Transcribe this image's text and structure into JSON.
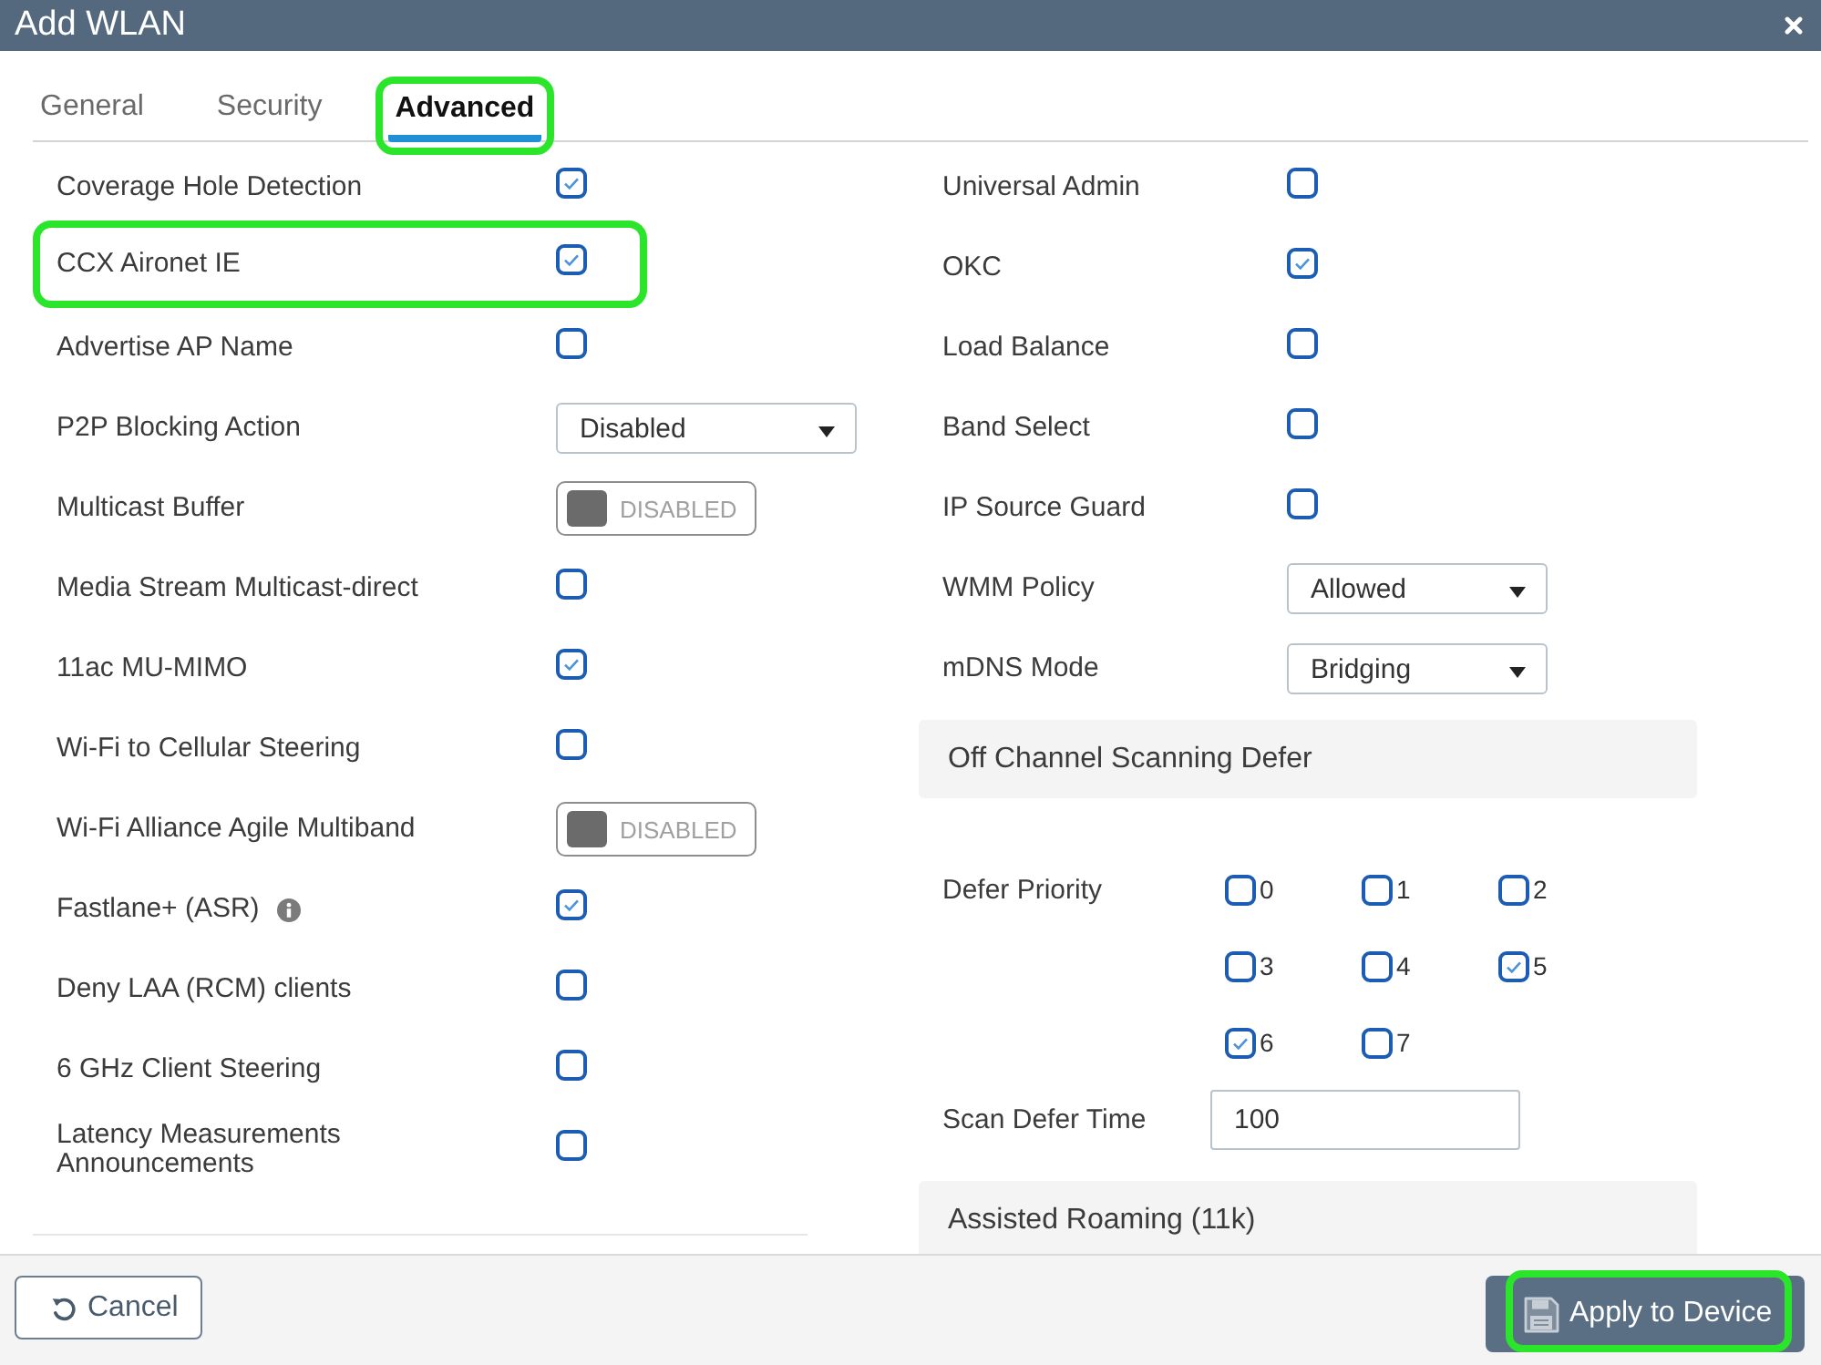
{
  "window": {
    "title": "Add WLAN"
  },
  "tabs": [
    {
      "label": "General",
      "selected": false,
      "highlighted": false
    },
    {
      "label": "Security",
      "selected": false,
      "highlighted": false
    },
    {
      "label": "Advanced",
      "selected": true,
      "highlighted": true
    }
  ],
  "left_settings": [
    {
      "kind": "checkbox",
      "label": "Coverage Hole Detection",
      "info": false,
      "highlighted": false,
      "checked": true
    },
    {
      "kind": "checkbox",
      "label": "CCX Aironet IE",
      "info": false,
      "highlighted": true,
      "checked": true
    },
    {
      "kind": "checkbox",
      "label": "Advertise AP Name",
      "info": false,
      "highlighted": false,
      "checked": false
    },
    {
      "kind": "select",
      "label": "P2P Blocking Action",
      "info": false,
      "highlighted": false,
      "value": "Disabled"
    },
    {
      "kind": "toggle",
      "label": "Multicast Buffer",
      "info": false,
      "highlighted": false,
      "on": false,
      "state_text": "DISABLED"
    },
    {
      "kind": "checkbox",
      "label": "Media Stream Multicast-direct",
      "info": false,
      "highlighted": false,
      "checked": false
    },
    {
      "kind": "checkbox",
      "label": "11ac MU-MIMO",
      "info": false,
      "highlighted": false,
      "checked": true
    },
    {
      "kind": "checkbox",
      "label": "Wi-Fi to Cellular Steering",
      "info": false,
      "highlighted": false,
      "checked": false
    },
    {
      "kind": "toggle",
      "label": "Wi-Fi Alliance Agile Multiband",
      "info": false,
      "highlighted": false,
      "on": false,
      "state_text": "DISABLED"
    },
    {
      "kind": "checkbox",
      "label": "Fastlane+ (ASR)",
      "info": true,
      "highlighted": false,
      "checked": true
    },
    {
      "kind": "checkbox",
      "label": "Deny LAA (RCM) clients",
      "info": false,
      "highlighted": false,
      "checked": false
    },
    {
      "kind": "checkbox",
      "label": "6 GHz Client Steering",
      "info": false,
      "highlighted": false,
      "checked": false
    },
    {
      "kind": "checkbox",
      "label": "Latency Measurements Announcements",
      "info": false,
      "highlighted": false,
      "checked": false
    }
  ],
  "right_settings": [
    {
      "kind": "checkbox",
      "label": "Universal Admin",
      "checked": false
    },
    {
      "kind": "checkbox",
      "label": "OKC",
      "checked": true
    },
    {
      "kind": "checkbox",
      "label": "Load Balance",
      "checked": false
    },
    {
      "kind": "checkbox",
      "label": "Band Select",
      "checked": false
    },
    {
      "kind": "checkbox",
      "label": "IP Source Guard",
      "checked": false
    },
    {
      "kind": "select",
      "label": "WMM Policy",
      "value": "Allowed"
    },
    {
      "kind": "select",
      "label": "mDNS Mode",
      "value": "Bridging"
    }
  ],
  "off_channel_scanning_defer": {
    "title": "Off Channel Scanning Defer",
    "defer_priority": {
      "label": "Defer Priority",
      "options": [
        {
          "label": "0",
          "checked": false
        },
        {
          "label": "1",
          "checked": false
        },
        {
          "label": "2",
          "checked": false
        },
        {
          "label": "3",
          "checked": false
        },
        {
          "label": "4",
          "checked": false
        },
        {
          "label": "5",
          "checked": true
        },
        {
          "label": "6",
          "checked": true
        },
        {
          "label": "7",
          "checked": false
        }
      ]
    },
    "scan_defer_time": {
      "label": "Scan Defer Time",
      "value": "100"
    }
  },
  "assisted_roaming": {
    "title": "Assisted Roaming (11k)"
  },
  "buttons": [
    {
      "kind": "cancel",
      "label": "Cancel",
      "highlighted": false
    },
    {
      "kind": "apply",
      "label": "Apply to Device",
      "highlighted": true
    }
  ]
}
